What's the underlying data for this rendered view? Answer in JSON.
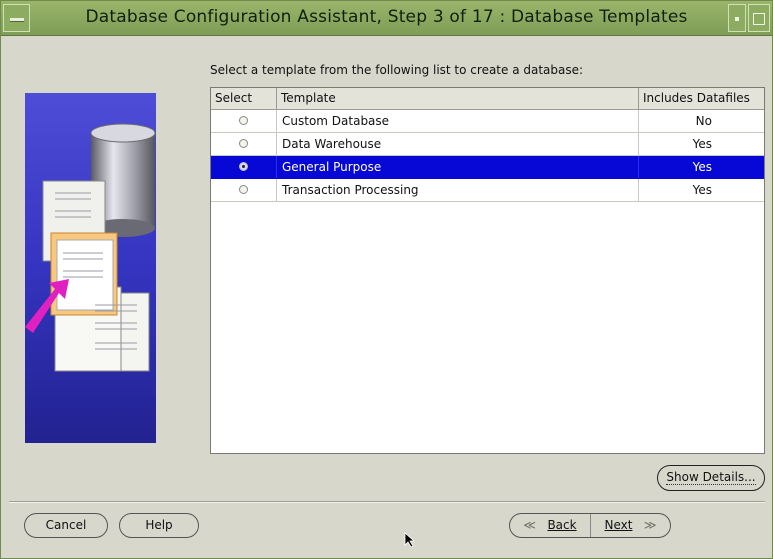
{
  "window": {
    "title": "Database Configuration Assistant, Step 3 of 17 : Database Templates"
  },
  "content": {
    "instruction": "Select a template from the following list to create a database:",
    "table": {
      "columns": [
        "Select",
        "Template",
        "Includes Datafiles"
      ],
      "rows": [
        {
          "template": "Custom Database",
          "includes_datafiles": "No",
          "selected": false
        },
        {
          "template": "Data Warehouse",
          "includes_datafiles": "Yes",
          "selected": false
        },
        {
          "template": "General Purpose",
          "includes_datafiles": "Yes",
          "selected": true
        },
        {
          "template": "Transaction Processing",
          "includes_datafiles": "Yes",
          "selected": false
        }
      ]
    },
    "show_details_label": "Show Details..."
  },
  "footer": {
    "cancel_label": "Cancel",
    "help_label": "Help",
    "back_label": "Back",
    "next_label": "Next"
  },
  "colors": {
    "titlebar": "#8fab63",
    "selection": "#0707d6",
    "illustration_bg": "#3b3bc8"
  }
}
